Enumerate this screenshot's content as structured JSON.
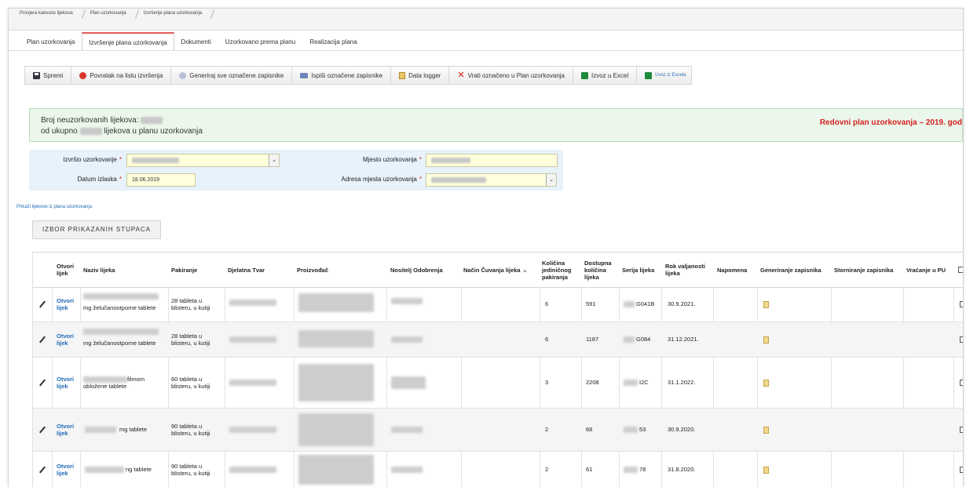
{
  "breadcrumb": [
    "Provjera kakvoće lijekova",
    "Plan uzorkovanja",
    "Izvršenje plana uzorkovanja"
  ],
  "tabs": [
    {
      "label": "Plan uzorkovanja",
      "active": false
    },
    {
      "label": "Izvršenje plana uzorkovanja",
      "active": true
    },
    {
      "label": "Dokumenti",
      "active": false
    },
    {
      "label": "Uzorkovano prema planu",
      "active": false
    },
    {
      "label": "Realizacija plana",
      "active": false
    }
  ],
  "toolbar": {
    "save": "Spremi",
    "back": "Povratak na listu izvršenja",
    "generate": "Generiraj sve označene zapisnike",
    "print": "Ispiši označene zapisnike",
    "datalogger": "Data logger",
    "revert": "Vrati označeno u Plan uzorkovanja",
    "export": "Izvoz u Excel",
    "import": "Uvoz iz Excela"
  },
  "info": {
    "line1": "Broj neuzorkovanih lijekova:",
    "line2_pre": "od ukupno",
    "line2_post": "lijekova u planu uzorkovanja",
    "plan": "Redovni plan uzorkovanja – 2019. god"
  },
  "form": {
    "sampler_label": "Izvršio uzorkovanje",
    "date_label": "Datum izlaska",
    "date_value": "18.06.2019",
    "place_label": "Mjesto uzorkovanja",
    "address_label": "Adresa mjesta uzorkovanja",
    "required_mark": "*"
  },
  "show_link": "Prikaži lijekove iz plana uzorkovanja",
  "columns_button": "IZBOR PRIKAZANIH STUPACA",
  "table": {
    "headers": {
      "open": "Otvori lijek",
      "name": "Naziv lijeka",
      "pack": "Pakiranje",
      "substance": "Djelatna Tvar",
      "maker": "Proizvođač",
      "holder": "Nositelj Odobrenja",
      "storage": "Način Čuvanja lijeka",
      "qty": "Količina jediničnog pakiranja",
      "avail": "Dostupna količina lijeka",
      "batch": "Serija lijeka",
      "expiry": "Rok valjanosti lijeka",
      "note": "Napomena",
      "generate": "Generiranje zapisnika",
      "cancel": "Storniranje zapisnika",
      "return": "Vraćanje u PU"
    },
    "open_label": "Otvori lijek",
    "rows": [
      {
        "name": "mg želučanootporne tablete",
        "pack": "28 tableta u blisteru, u kutiji",
        "qty": "6",
        "avail": "591",
        "batch": "G041B",
        "expiry": "30.9.2021."
      },
      {
        "name": "mg želučanootporne tablete",
        "pack": "28 tableta u blisteru, u kutiji",
        "qty": "6",
        "avail": "1187",
        "batch": "G084",
        "expiry": "31.12.2021."
      },
      {
        "name": "filmom obložene tablete",
        "pack": "60 tableta u blisteru, u kutiji",
        "qty": "3",
        "avail": "2208",
        "batch": "I2C",
        "expiry": "31.1.2022."
      },
      {
        "name": "mg tablete",
        "pack": "90 tableta u blisteru, u kutiji",
        "qty": "2",
        "avail": "68",
        "batch": "53",
        "expiry": "30.9.2020."
      },
      {
        "name": "ng tablete",
        "pack": "90 tableta u blisteru, u kutiji",
        "qty": "2",
        "avail": "61",
        "batch": "78",
        "expiry": "31.8.2020."
      }
    ]
  },
  "colors": {
    "accent_red": "#d61f1f",
    "link_blue": "#1f6bb5",
    "info_bg": "#eaf7ea",
    "form_bg": "#e7f2fb",
    "input_bg": "#ffffdc"
  }
}
